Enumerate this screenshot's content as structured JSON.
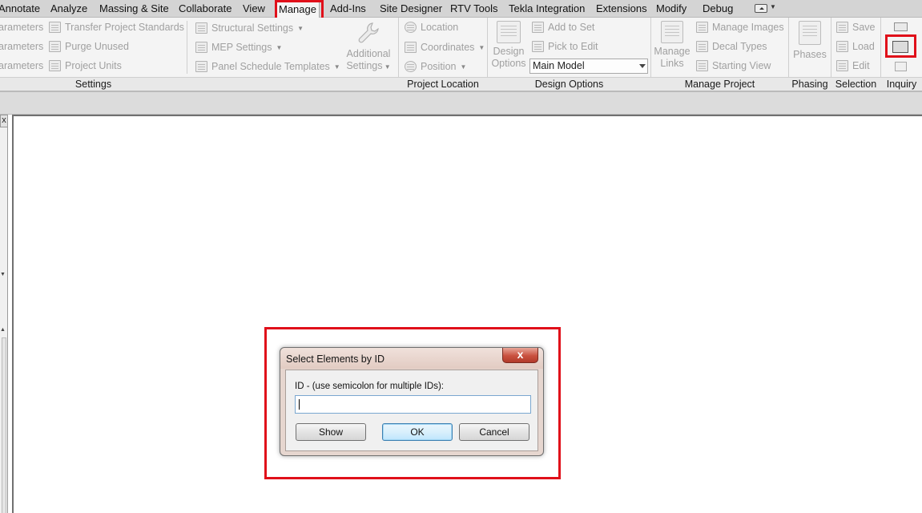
{
  "tabs": [
    {
      "label": "Annotate",
      "active": false
    },
    {
      "label": "Analyze",
      "active": false
    },
    {
      "label": "Massing & Site",
      "active": false
    },
    {
      "label": "Collaborate",
      "active": false
    },
    {
      "label": "View",
      "active": false
    },
    {
      "label": "Manage",
      "active": true
    },
    {
      "label": "Add-Ins",
      "active": false
    },
    {
      "label": "Site Designer",
      "active": false
    },
    {
      "label": "RTV Tools",
      "active": false
    },
    {
      "label": "Tekla Integration",
      "active": false
    },
    {
      "label": "Extensions",
      "active": false
    },
    {
      "label": "Modify",
      "active": false
    },
    {
      "label": "Debug",
      "active": false
    }
  ],
  "ribbon": {
    "settings": {
      "title": "Settings",
      "items": {
        "params1": "arameters",
        "params2": "arameters",
        "params3": "arameters",
        "transfer": "Transfer Project Standards",
        "purge": "Purge Unused",
        "units": "Project Units",
        "structural": "Structural Settings",
        "mep": "MEP Settings",
        "panel": "Panel Schedule Templates",
        "additional_line1": "Additional",
        "additional_line2": "Settings"
      }
    },
    "project_location": {
      "title": "Project Location",
      "items": {
        "location": "Location",
        "coordinates": "Coordinates",
        "position": "Position"
      }
    },
    "design_options": {
      "title": "Design Options",
      "items": {
        "design_line1": "Design",
        "design_line2": "Options",
        "add_to_set": "Add to Set",
        "pick_to_edit": "Pick to Edit",
        "selector_value": "Main Model"
      }
    },
    "manage_project": {
      "title": "Manage Project",
      "items": {
        "links_line1": "Manage",
        "links_line2": "Links",
        "manage_images": "Manage Images",
        "decal_types": "Decal Types",
        "starting_view": "Starting View"
      }
    },
    "phasing": {
      "title": "Phasing",
      "items": {
        "phases": "Phases"
      }
    },
    "selection": {
      "title": "Selection",
      "items": {
        "save": "Save",
        "load": "Load",
        "edit": "Edit"
      }
    },
    "inquiry": {
      "title": "Inquiry"
    }
  },
  "dialog": {
    "title": "Select Elements by ID",
    "close_label": "x",
    "field_label": "ID - (use semicolon for multiple IDs):",
    "field_value": "",
    "buttons": {
      "show": "Show",
      "ok": "OK",
      "cancel": "Cancel"
    }
  },
  "sidebar": {
    "close_label": "x"
  },
  "icons": [
    "quick-access-icon",
    "transfer-standards-icon",
    "purge-icon",
    "project-units-icon",
    "structural-settings-icon",
    "mep-settings-icon",
    "panel-schedule-icon",
    "wrench-icon",
    "location-icon",
    "coordinates-icon",
    "position-icon",
    "design-options-icon",
    "add-to-set-icon",
    "pick-to-edit-icon",
    "manage-links-icon",
    "manage-images-icon",
    "decal-types-icon",
    "starting-view-icon",
    "phases-icon",
    "selection-save-icon",
    "selection-load-icon",
    "selection-edit-icon",
    "ids-of-selection-icon",
    "select-by-id-icon",
    "warnings-icon"
  ],
  "colors": {
    "highlight": "#e0101a",
    "ribbon_background": "#f4f4f4",
    "tab_bar": "#d4d4d4"
  }
}
